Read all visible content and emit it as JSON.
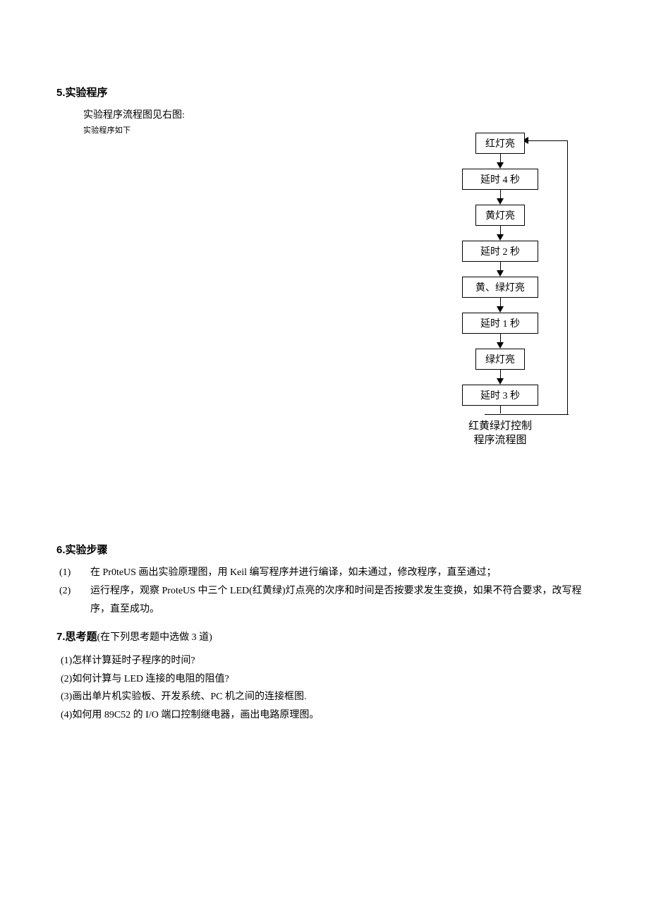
{
  "section5": {
    "heading": "5.实验程序",
    "intro": "实验程序流程图见右图:",
    "sub": "实验程序如下"
  },
  "flowchart": {
    "nodes": [
      "红灯亮",
      "延时 4 秒",
      "黄灯亮",
      "延时 2 秒",
      "黄、绿灯亮",
      "延时 1 秒",
      "绿灯亮",
      "延时 3 秒"
    ],
    "caption_line1": "红黄绿灯控制",
    "caption_line2": "程序流程图"
  },
  "section6": {
    "heading": "6.实验步骤",
    "items": [
      {
        "num": "(1)",
        "text": "在 Pr0teUS 画出实验原理图，用 Keil 编写程序并进行编译，如未通过，修改程序，直至通过；"
      },
      {
        "num": "(2)",
        "text": "运行程序，观察 ProteUS 中三个 LED(红黄绿)灯点亮的次序和时间是否按要求发生变换，如果不符合要求，改写程序，直至成功。"
      }
    ]
  },
  "section7": {
    "heading": "7.思考题",
    "subtitle": "(在下列思考题中选做 3 道)",
    "items": [
      "(1)怎样计算延时子程序的时间?",
      "(2)如何计算与 LED 连接的电阻的阻值?",
      "(3)画出单片机实验板、开发系统、PC 机之间的连接框图.",
      "(4)如何用 89C52 的 I/O 端口控制继电器，画出电路原理图。"
    ]
  }
}
